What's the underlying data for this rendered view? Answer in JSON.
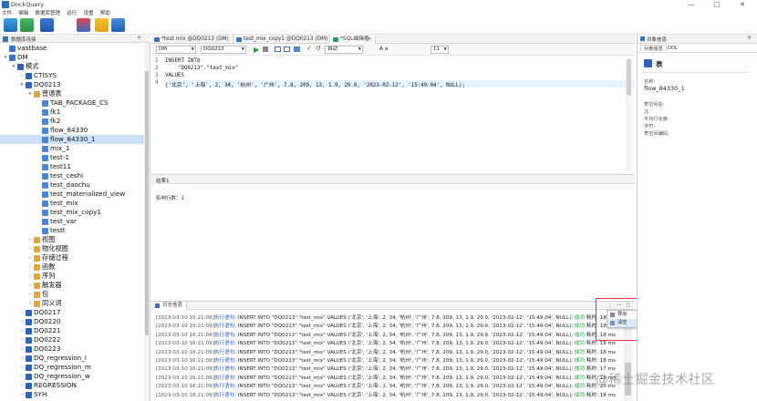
{
  "window": {
    "title": "DockQuery",
    "minimize": "—",
    "maximize": "□",
    "close": "✕"
  },
  "menu": [
    "文件",
    "编辑",
    "数据库管理",
    "运行",
    "设置",
    "帮助"
  ],
  "toolbar": {
    "icons": [
      "new-connection-icon",
      "database-icon",
      "sql-editor-icon",
      "tools-icon",
      "export-icon",
      "save-icon"
    ]
  },
  "left_panel": {
    "title": "数据库连接",
    "tree": [
      {
        "label": "vastbase",
        "level": 0,
        "arrow": "",
        "icon": "db"
      },
      {
        "label": "DM",
        "level": 0,
        "arrow": "▾",
        "icon": "db"
      },
      {
        "label": "模式",
        "level": 1,
        "arrow": "▾",
        "icon": "schema"
      },
      {
        "label": "CTISYS",
        "level": 2,
        "arrow": "›",
        "icon": "schema"
      },
      {
        "label": "DQ0213",
        "level": 2,
        "arrow": "▾",
        "icon": "schema"
      },
      {
        "label": "普通表",
        "level": 3,
        "arrow": "▾",
        "icon": "folder"
      },
      {
        "label": "TAB_PACKAGE_CS",
        "level": 4,
        "arrow": "",
        "icon": "table"
      },
      {
        "label": "fk1",
        "level": 4,
        "arrow": "",
        "icon": "table"
      },
      {
        "label": "fk2",
        "level": 4,
        "arrow": "",
        "icon": "table"
      },
      {
        "label": "flow_84330",
        "level": 4,
        "arrow": "",
        "icon": "table"
      },
      {
        "label": "flow_84330_1",
        "level": 4,
        "arrow": "",
        "icon": "table",
        "selected": true
      },
      {
        "label": "mix_1",
        "level": 4,
        "arrow": "",
        "icon": "table"
      },
      {
        "label": "test-1",
        "level": 4,
        "arrow": "",
        "icon": "table"
      },
      {
        "label": "test11",
        "level": 4,
        "arrow": "",
        "icon": "table"
      },
      {
        "label": "test_ceshi",
        "level": 4,
        "arrow": "",
        "icon": "table"
      },
      {
        "label": "test_daochu",
        "level": 4,
        "arrow": "",
        "icon": "table"
      },
      {
        "label": "test_materialized_view",
        "level": 4,
        "arrow": "",
        "icon": "table"
      },
      {
        "label": "test_mix",
        "level": 4,
        "arrow": "",
        "icon": "table"
      },
      {
        "label": "test_mix_copy1",
        "level": 4,
        "arrow": "",
        "icon": "table"
      },
      {
        "label": "test_var",
        "level": 4,
        "arrow": "",
        "icon": "table"
      },
      {
        "label": "testt",
        "level": 4,
        "arrow": "",
        "icon": "table"
      },
      {
        "label": "视图",
        "level": 3,
        "arrow": "›",
        "icon": "folder"
      },
      {
        "label": "物化视图",
        "level": 3,
        "arrow": "›",
        "icon": "folder"
      },
      {
        "label": "存储过程",
        "level": 3,
        "arrow": "›",
        "icon": "folder"
      },
      {
        "label": "函数",
        "level": 3,
        "arrow": "›",
        "icon": "folder"
      },
      {
        "label": "序列",
        "level": 3,
        "arrow": "›",
        "icon": "folder"
      },
      {
        "label": "触发器",
        "level": 3,
        "arrow": "›",
        "icon": "folder"
      },
      {
        "label": "包",
        "level": 3,
        "arrow": "›",
        "icon": "folder"
      },
      {
        "label": "同义词",
        "level": 3,
        "arrow": "›",
        "icon": "folder"
      },
      {
        "label": "DQ0217",
        "level": 2,
        "arrow": "›",
        "icon": "schema"
      },
      {
        "label": "DQ0220",
        "level": 2,
        "arrow": "›",
        "icon": "schema"
      },
      {
        "label": "DQ0221",
        "level": 2,
        "arrow": "›",
        "icon": "schema"
      },
      {
        "label": "DQ0222",
        "level": 2,
        "arrow": "›",
        "icon": "schema"
      },
      {
        "label": "DQ0223",
        "level": 2,
        "arrow": "›",
        "icon": "schema"
      },
      {
        "label": "DQ_regression_l",
        "level": 2,
        "arrow": "›",
        "icon": "schema"
      },
      {
        "label": "DQ_regression_m",
        "level": 2,
        "arrow": "›",
        "icon": "schema"
      },
      {
        "label": "DQ_regression_w",
        "level": 2,
        "arrow": "›",
        "icon": "schema"
      },
      {
        "label": "REGRESSION",
        "level": 2,
        "arrow": "›",
        "icon": "schema"
      },
      {
        "label": "SYH",
        "level": 2,
        "arrow": "›",
        "icon": "schema"
      }
    ]
  },
  "editor_tabs": [
    {
      "label": "*test mix @DQ0213 (DM)",
      "active": false
    },
    {
      "label": "test_mix_copy1 @DQ0213 (DM)",
      "active": false
    },
    {
      "label": "*SQL编辑器",
      "active": true
    }
  ],
  "editor_toolbar": {
    "connection": "DM",
    "schema": "DQ0213",
    "mode": "自动",
    "font_label": "A a",
    "font_size": "11"
  },
  "sql_lines": [
    "INSERT INTO",
    "    \"DQ0213\".\"test_mix\"",
    "VALUES",
    "('北京', '上海', 2, 34, '杭州', '广州', 7.8, 209, 13, 1.9, 29.0, '2023-02-12', '15:49:04', NULL);"
  ],
  "result_tab": "结果1",
  "result_message": "影响行数：1",
  "log_tab": "日志信息",
  "log_lines": [
    {
      "ts": "[2023-03-10 16:21:09]",
      "action": "执行语句:",
      "sql": " INSERT INTO \"DQ0213\".\"test_mix\" VALUES ('北京', '上海', 2, 34, '杭州', '广州', 7.8, 209, 13, 1.9, 29.0, '2023-02-12', '15:49:04', NULL); ",
      "ok": "成功",
      "time": " 耗时: 18 ms"
    },
    {
      "ts": "[2023-03-10 16:21:09]",
      "action": "执行语句:",
      "sql": " INSERT INTO \"DQ0213\".\"test_mix\" VALUES ('北京', '上海', 2, 34, '杭州', '广州', 7.8, 209, 13, 1.9, 29.0, '2023-02-12', '15:49:04', NULL); ",
      "ok": "成功",
      "time": " 耗时: 18 ms"
    },
    {
      "ts": "[2023-03-10 16:21:09]",
      "action": "执行语句:",
      "sql": " INSERT INTO \"DQ0213\".\"test_mix\" VALUES ('北京', '上海', 2, 34, '杭州', '广州', 7.8, 209, 13, 1.9, 29.0, '2023-02-12', '15:49:04', NULL); ",
      "ok": "成功",
      "time": " 耗时: 18 ms"
    },
    {
      "ts": "[2023-03-10 16:21:09]",
      "action": "执行语句:",
      "sql": " INSERT INTO \"DQ0213\".\"test_mix\" VALUES ('北京', '上海', 2, 34, '杭州', '广州', 7.8, 209, 13, 1.9, 29.0, '2023-02-12', '15:49:04', NULL); ",
      "ok": "成功",
      "time": " 耗时: 18 ms"
    },
    {
      "ts": "[2023-03-10 16:21:09]",
      "action": "执行语句:",
      "sql": " INSERT INTO \"DQ0213\".\"test_mix\" VALUES ('北京', '上海', 2, 34, '杭州', '广州', 7.8, 209, 13, 1.9, 29.0, '2023-02-12', '15:49:04', NULL); ",
      "ok": "成功",
      "time": " 耗时: 18 ms"
    },
    {
      "ts": "[2023-03-10 16:21:09]",
      "action": "执行语句:",
      "sql": " INSERT INTO \"DQ0213\".\"test_mix\" VALUES ('北京', '上海', 2, 34, '杭州', '广州', 7.8, 209, 13, 1.9, 29.0, '2023-02-12', '15:49:04', NULL); ",
      "ok": "成功",
      "time": " 耗时: 18 ms"
    },
    {
      "ts": "[2023-03-10 16:21:09]",
      "action": "执行语句:",
      "sql": " INSERT INTO \"DQ0213\".\"test_mix\" VALUES ('北京', '上海', 2, 34, '杭州', '广州', 7.8, 209, 13, 1.9, 29.0, '2023-02-12', '15:49:04', NULL); ",
      "ok": "成功",
      "time": " 耗时: 17 ms"
    },
    {
      "ts": "[2023-03-10 16:21:09]",
      "action": "执行语句:",
      "sql": " INSERT INTO \"DQ0213\".\"test_mix\" VALUES ('北京', '上海', 2, 34, '杭州', '广州', 7.8, 209, 13, 1.9, 29.0, '2023-02-12', '15:49:04', NULL); ",
      "ok": "成功",
      "time": " 耗时: 18 ms"
    },
    {
      "ts": "[2023-03-10 16:21:09]",
      "action": "执行语句:",
      "sql": " INSERT INTO \"DQ0213\".\"test_mix\" VALUES ('北京', '上海', 2, 34, '杭州', '广州', 7.8, 209, 13, 1.9, 29.0, '2023-02-12', '15:49:04', NULL); ",
      "ok": "成功",
      "time": " 耗时: 20 ms"
    },
    {
      "ts": "[2023-03-10 16:21:09]",
      "action": "执行语句:",
      "sql": " INSERT INTO \"DQ0213\".\"test_mix\" VALUES ('北京', '上海', 2, 34, '杭州', '广州', 7.8, 209, 13, 1.9, 29.0, '2023-02-12', '15:49:04', NULL); ",
      "ok": "成功",
      "time": " 耗时: 18 ms"
    }
  ],
  "context_menu": {
    "items": [
      "导出",
      "清空"
    ],
    "highlighted_index": 1
  },
  "right_panel": {
    "title": "对象信息",
    "tabs": [
      "对象信息",
      "DDL"
    ],
    "heading": "表",
    "props": [
      {
        "label": "名称:",
        "value": "flow_84330_1"
      },
      {
        "label": "表空间名:",
        "value": ""
      },
      {
        "label": "注:",
        "value": ""
      },
      {
        "label": "平均行长度:",
        "value": ""
      },
      {
        "label": "字符:",
        "value": ""
      },
      {
        "label": "表空间编码:",
        "value": ""
      }
    ]
  },
  "watermark": "@稀土掘金技术社区",
  "colors": {
    "accent": "#2b55c7",
    "success": "#1a9a3a",
    "highlight_box": "#e0343a",
    "selection": "#cce3fb"
  }
}
